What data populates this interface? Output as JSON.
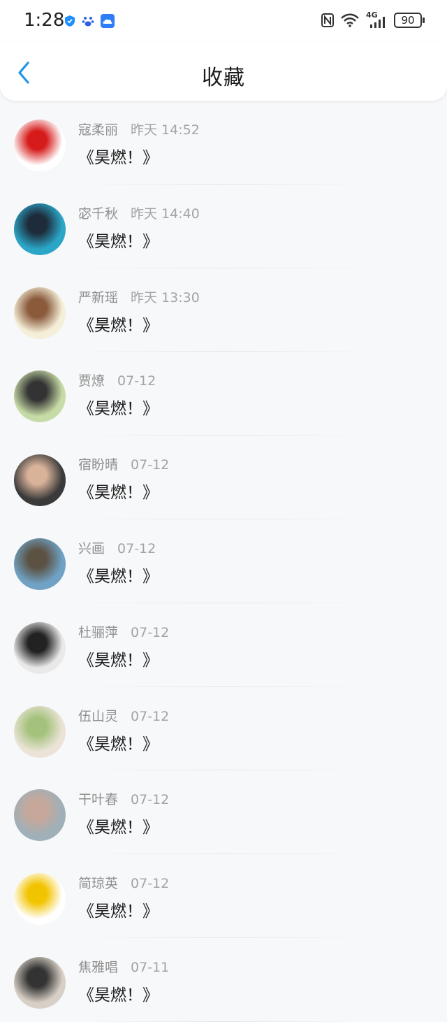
{
  "status_bar": {
    "time": "1:28",
    "battery": "90",
    "network": "4G"
  },
  "nav": {
    "title": "收藏"
  },
  "items": [
    {
      "name": "寇柔丽",
      "time": "昨天 14:52",
      "content": "《昊燃！》",
      "avatar_colors": [
        "#ffffff",
        "#d61b1b"
      ]
    },
    {
      "name": "宓千秋",
      "time": "昨天 14:40",
      "content": "《昊燃！》",
      "avatar_colors": [
        "#2ba6c7",
        "#1e2b3a"
      ]
    },
    {
      "name": "严新瑶",
      "time": "昨天 13:30",
      "content": "《昊燃！》",
      "avatar_colors": [
        "#f5efd9",
        "#8a5a3b"
      ]
    },
    {
      "name": "贾燎",
      "time": "07-12",
      "content": "《昊燃！》",
      "avatar_colors": [
        "#c7dba6",
        "#333333"
      ]
    },
    {
      "name": "宿盼晴",
      "time": "07-12",
      "content": "《昊燃！》",
      "avatar_colors": [
        "#3a3a3a",
        "#d9b29a"
      ]
    },
    {
      "name": "兴画",
      "time": "07-12",
      "content": "《昊燃！》",
      "avatar_colors": [
        "#6fa2c4",
        "#5c5244"
      ]
    },
    {
      "name": "杜骊萍",
      "time": "07-12",
      "content": "《昊燃！》",
      "avatar_colors": [
        "#e9e9e9",
        "#222222"
      ]
    },
    {
      "name": "伍山灵",
      "time": "07-12",
      "content": "《昊燃！》",
      "avatar_colors": [
        "#eae3d6",
        "#a5c27c"
      ]
    },
    {
      "name": "干叶春",
      "time": "07-12",
      "content": "《昊燃！》",
      "avatar_colors": [
        "#9fb0b8",
        "#c7a79a"
      ]
    },
    {
      "name": "简琼英",
      "time": "07-12",
      "content": "《昊燃！》",
      "avatar_colors": [
        "#ffffff",
        "#f2c400"
      ]
    },
    {
      "name": "焦雅唱",
      "time": "07-11",
      "content": "《昊燃！》",
      "avatar_colors": [
        "#d8d0c6",
        "#333333"
      ]
    }
  ]
}
